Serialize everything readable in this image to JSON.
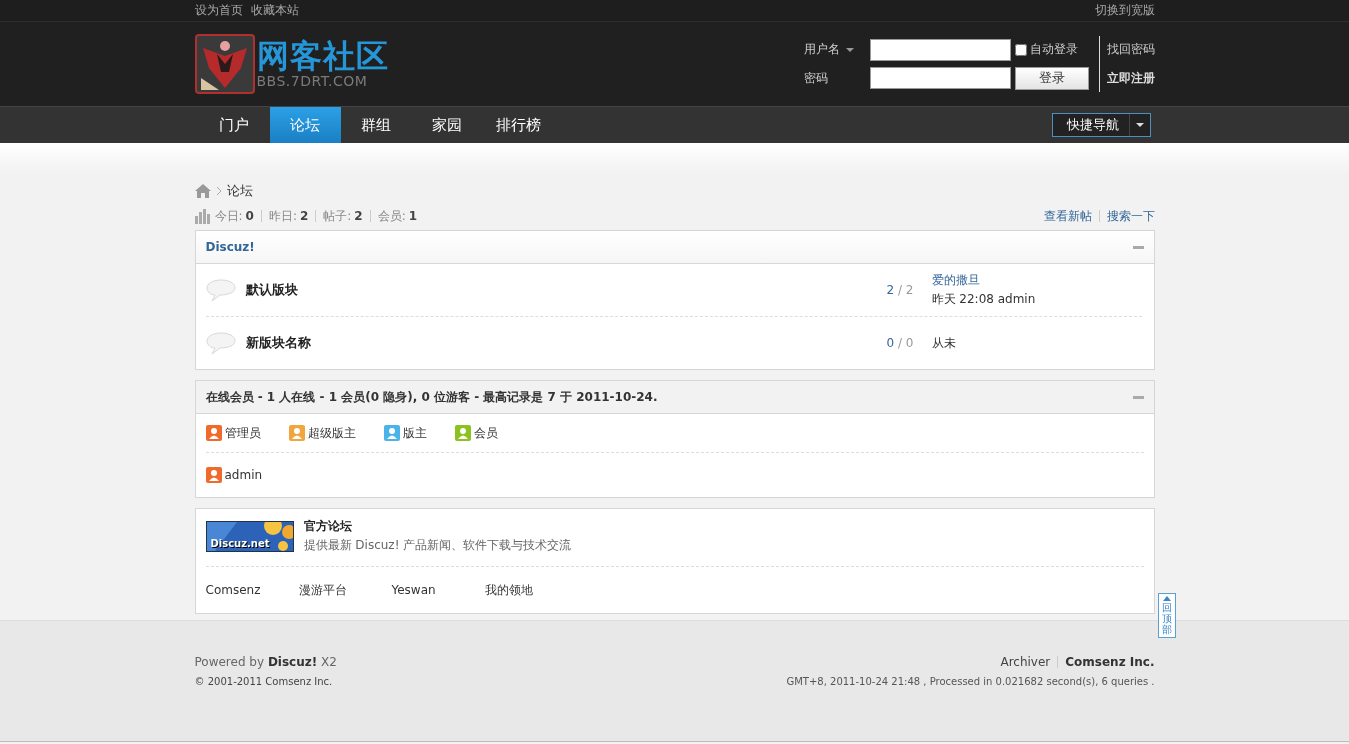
{
  "top_bar": {
    "links": [
      "设为首页",
      "收藏本站"
    ],
    "wide_switch": "切换到宽版"
  },
  "header": {
    "logo": {
      "title": "网客社区",
      "domain": "BBS.7DRT.COM"
    },
    "login": {
      "username_label": "用户名",
      "password_label": "密码",
      "auto_login": {
        "label": "自动登录",
        "checked": false
      },
      "login_button": "登录",
      "forgot_link": "找回密码",
      "register_link": "立即注册"
    }
  },
  "nav": {
    "tabs": [
      {
        "label": "门户",
        "selected": false
      },
      {
        "label": "论坛",
        "selected": true
      },
      {
        "label": "群组",
        "selected": false
      },
      {
        "label": "家园",
        "selected": false
      },
      {
        "label": "排行榜",
        "selected": false
      }
    ],
    "quick_nav": "快捷导航"
  },
  "breadcrumb": [
    "论坛"
  ],
  "stats": [
    {
      "label": "今日:",
      "value": "0"
    },
    {
      "label": "昨日:",
      "value": "2"
    },
    {
      "label": "帖子:",
      "value": "2"
    },
    {
      "label": "会员:",
      "value": "1"
    }
  ],
  "stats_links": [
    "查看新帖",
    "搜索一下"
  ],
  "category": {
    "title": "Discuz!",
    "count_separator": "/",
    "forums": [
      {
        "name": "默认版块",
        "topics": "2",
        "posts": "2",
        "last_post": {
          "title": "爱的撒旦",
          "time": "昨天 22:08",
          "author": "admin"
        }
      },
      {
        "name": "新版块名称",
        "topics": "0",
        "posts": "0",
        "last_post_text": "从未"
      }
    ]
  },
  "online": {
    "summary": "在线会员 - 1 人在线 - 1 会员(0 隐身), 0 位游客 - 最高记录是 7 于 2011-10-24.",
    "legend": [
      {
        "label": "管理员",
        "color": "#f06a2c"
      },
      {
        "label": "超级版主",
        "color": "#f0a63c"
      },
      {
        "label": "版主",
        "color": "#4ab4e8"
      },
      {
        "label": "会员",
        "color": "#8cc21e"
      }
    ],
    "users": [
      {
        "name": "admin",
        "color": "#f06a2c"
      }
    ]
  },
  "friend_links": {
    "featured": {
      "logo_text": "Discuz.net",
      "name": "官方论坛",
      "description": "提供最新 Discuz! 产品新闻、软件下载与技术交流"
    },
    "links": [
      "Comsenz",
      "漫游平台",
      "Yeswan",
      "我的领地"
    ]
  },
  "footer": {
    "powered": "Powered by **Discuz!** X2",
    "copyright": "© 2001-2011 Comsenz Inc.",
    "links": [
      "Archiver",
      "Comsenz Inc."
    ],
    "debug": "GMT+8, 2011-10-24 21:48 , Processed in 0.021682 second(s), 6 queries ."
  },
  "back_to_top": "回顶部"
}
